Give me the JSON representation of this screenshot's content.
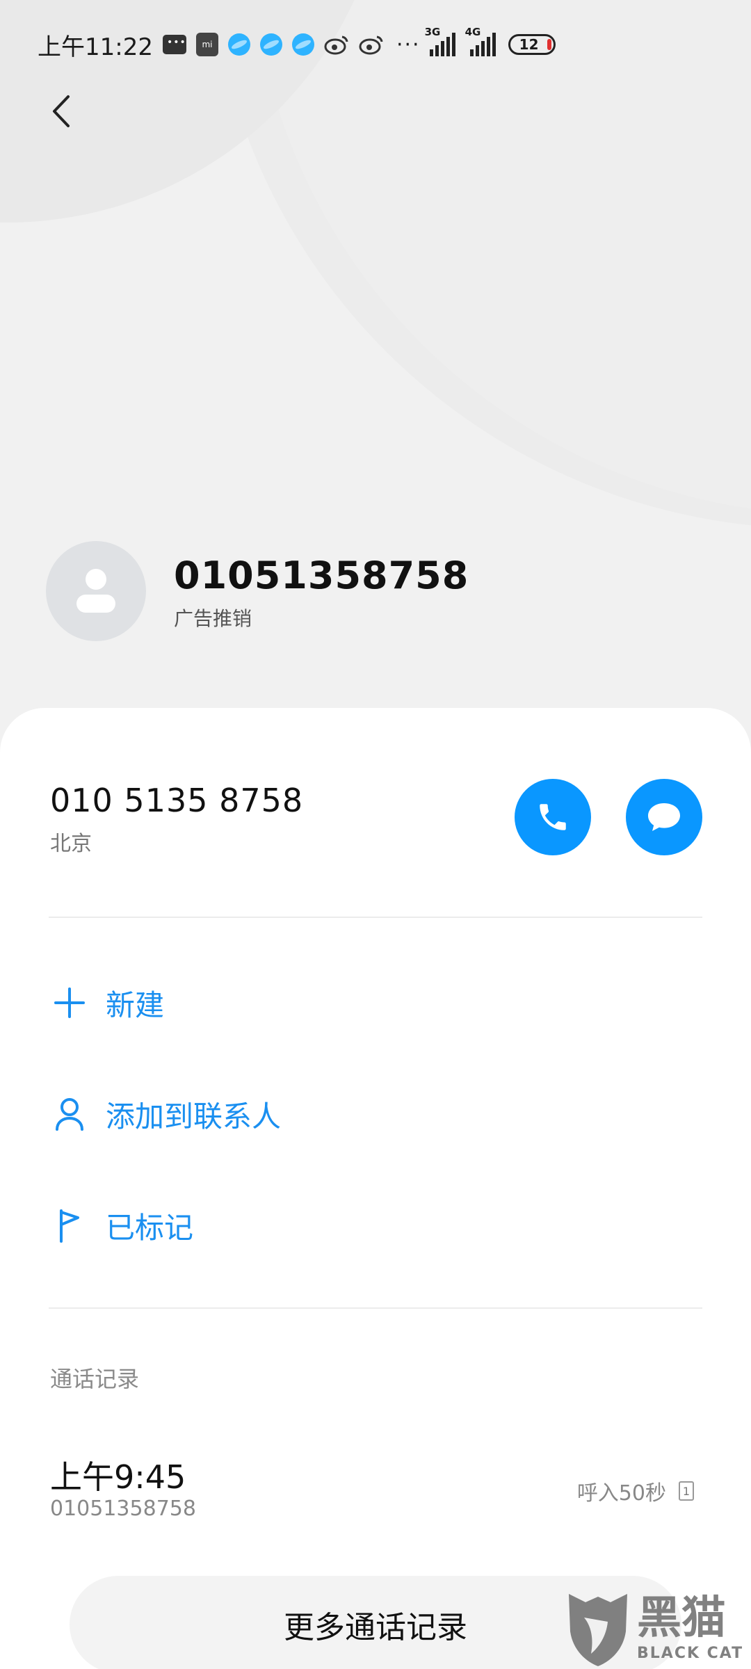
{
  "status_bar": {
    "time": "上午11:22",
    "net_1": "3G",
    "net_2": "4G",
    "battery": "12",
    "overflow": "···"
  },
  "contact": {
    "name": "01051358758",
    "tag": "广告推销"
  },
  "phone": {
    "number": "010 5135 8758",
    "location": "北京"
  },
  "actions": [
    {
      "label": "新建",
      "icon": "plus-icon"
    },
    {
      "label": "添加到联系人",
      "icon": "person-icon"
    },
    {
      "label": "已标记",
      "icon": "flag-icon"
    }
  ],
  "call_log": {
    "title": "通话记录",
    "entries": [
      {
        "time": "上午9:45",
        "number": "01051358758",
        "status": "呼入50秒",
        "sim": "1"
      }
    ],
    "more_label": "更多通话记录"
  },
  "watermark": {
    "cn": "黑猫",
    "en": "BLACK CAT"
  },
  "colors": {
    "accent": "#0a97ff",
    "action_text": "#1a8ff0"
  }
}
